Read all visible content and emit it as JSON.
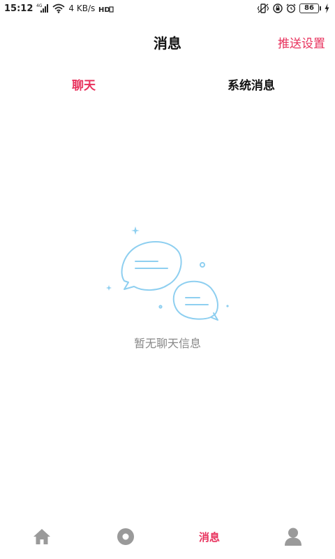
{
  "status_bar": {
    "time": "15:12",
    "network_label": "4G",
    "speed": "4 KB/s",
    "hd_label": "HD",
    "battery": "86"
  },
  "header": {
    "title": "消息",
    "push_settings": "推送设置"
  },
  "tabs": [
    {
      "label": "聊天",
      "active": true
    },
    {
      "label": "系统消息",
      "active": false
    }
  ],
  "empty_state": {
    "text": "暂无聊天信息",
    "icon": "chat-bubbles-icon"
  },
  "bottom_nav": {
    "items": [
      {
        "icon": "home-icon",
        "active": false
      },
      {
        "icon": "disc-icon",
        "active": false
      },
      {
        "label": "消息",
        "active": true
      },
      {
        "icon": "user-icon",
        "active": false
      }
    ]
  },
  "colors": {
    "accent": "#e8325d",
    "illustration": "#8ecff0",
    "nav_inactive": "#9a9a9a",
    "empty_text": "#888888"
  }
}
